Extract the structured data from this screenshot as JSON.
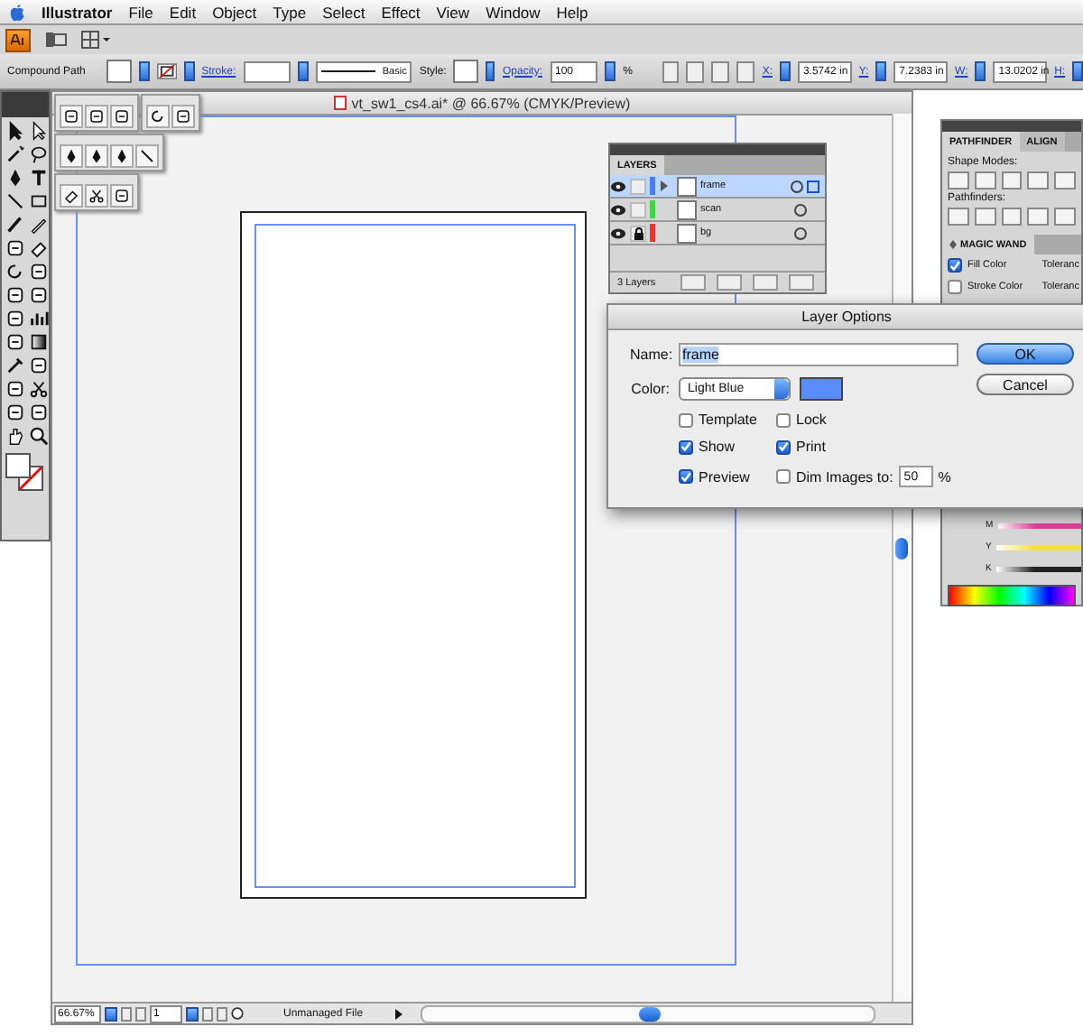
{
  "menubar": {
    "app": "Illustrator",
    "items": [
      "File",
      "Edit",
      "Object",
      "Type",
      "Select",
      "Effect",
      "View",
      "Window",
      "Help"
    ]
  },
  "control_bar": {
    "selection": "Compound Path",
    "stroke_label": "Stroke:",
    "brush": "Basic",
    "style_label": "Style:",
    "opacity_label": "Opacity:",
    "opacity": "100",
    "opacity_unit": "%",
    "fields": [
      {
        "label": "X:",
        "value": "3.5742 in"
      },
      {
        "label": "Y:",
        "value": "7.2383 in"
      },
      {
        "label": "W:",
        "value": "13.0202 in"
      },
      {
        "label": "H:"
      }
    ]
  },
  "document": {
    "title": "vt_sw1_cs4.ai* @ 66.67% (CMYK/Preview)",
    "zoom": "66.67%",
    "artboard": "1",
    "status": "Unmanaged File"
  },
  "layers_panel": {
    "tab": "LAYERS",
    "count": "3 Layers",
    "layers": [
      {
        "name": "frame",
        "color": "#4a7cff",
        "locked": false,
        "expandable": true,
        "selected": true
      },
      {
        "name": "scan",
        "color": "#33dd44",
        "locked": false,
        "expandable": false,
        "selected": false
      },
      {
        "name": "bg",
        "color": "#ee3333",
        "locked": true,
        "expandable": false,
        "selected": false
      }
    ]
  },
  "pathfinder_panel": {
    "tabs": [
      {
        "label": "PATHFINDER",
        "selected": true
      },
      {
        "label": "ALIGN",
        "selected": false
      }
    ],
    "shape_modes": "Shape Modes:",
    "pathfinders": "Pathfinders:"
  },
  "magic_wand_panel": {
    "title": "MAGIC WAND",
    "options": [
      {
        "label": "Fill Color",
        "checked": true,
        "tolerance": "Toleranc"
      },
      {
        "label": "Stroke Color",
        "checked": false,
        "tolerance": "Toleranc"
      }
    ]
  },
  "color_panel": {
    "channels": [
      {
        "label": "M",
        "color": "#e0409a"
      },
      {
        "label": "Y",
        "color": "#f0e040"
      },
      {
        "label": "K",
        "color": "#222222"
      }
    ]
  },
  "dialog": {
    "title": "Layer Options",
    "name_label": "Name:",
    "name": "frame",
    "color_label": "Color:",
    "color_name": "Light Blue",
    "color": "#5b8cff",
    "checkboxes": [
      {
        "label": "Template",
        "checked": false
      },
      {
        "label": "Lock",
        "checked": false
      },
      {
        "label": "Show",
        "checked": true
      },
      {
        "label": "Print",
        "checked": true
      },
      {
        "label": "Preview",
        "checked": true
      },
      {
        "label": "Dim Images to:",
        "checked": false
      }
    ],
    "dim_value": "50",
    "dim_unit": "%",
    "buttons": [
      {
        "label": "OK",
        "default": true
      },
      {
        "label": "Cancel",
        "default": false
      }
    ]
  }
}
